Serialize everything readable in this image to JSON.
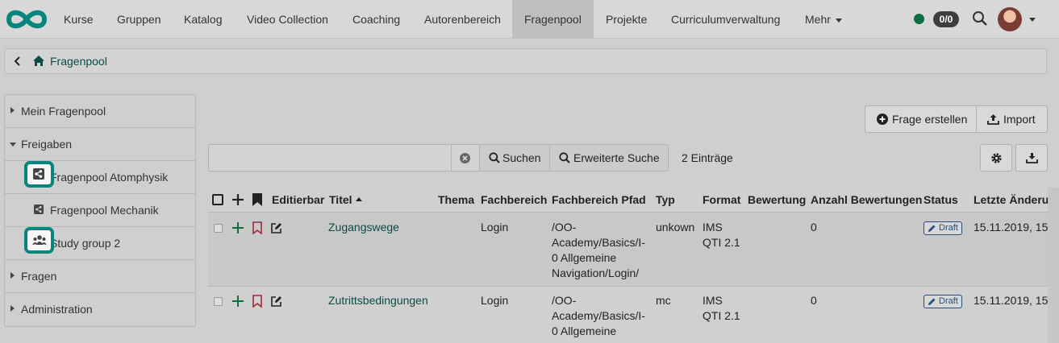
{
  "nav": {
    "items": [
      {
        "label": "Kurse",
        "active": false
      },
      {
        "label": "Gruppen",
        "active": false
      },
      {
        "label": "Katalog",
        "active": false
      },
      {
        "label": "Video Collection",
        "active": false
      },
      {
        "label": "Coaching",
        "active": false
      },
      {
        "label": "Autorenbereich",
        "active": false
      },
      {
        "label": "Fragenpool",
        "active": true
      },
      {
        "label": "Projekte",
        "active": false
      },
      {
        "label": "Curriculumverwaltung",
        "active": false
      },
      {
        "label": "Mehr",
        "active": false
      }
    ],
    "status_color": "#0d6e42",
    "badge": "0/0"
  },
  "breadcrumb": {
    "label": "Fragenpool"
  },
  "sidebar": {
    "items": [
      {
        "label": "Mein Fragenpool",
        "expanded": false
      },
      {
        "label": "Freigaben",
        "expanded": true
      },
      {
        "label": "Fragenpool Atomphysik",
        "icon": "share-icon",
        "highlighted": true
      },
      {
        "label": "Fragenpool Mechanik",
        "icon": "share-icon",
        "highlighted": false
      },
      {
        "label": "Study group 2",
        "icon": "group-icon",
        "highlighted": true
      },
      {
        "label": "Fragen",
        "expanded": false
      },
      {
        "label": "Administration",
        "expanded": false
      }
    ]
  },
  "toolbar": {
    "create_label": "Frage erstellen",
    "import_label": "Import",
    "search_label": "Suchen",
    "advanced_search_label": "Erweiterte Suche",
    "search_value": "",
    "count_label": "2 Einträge"
  },
  "table": {
    "headers": [
      "Editierbar",
      "Titel",
      "Thema",
      "Fachbereich",
      "Fachbereich Pfad",
      "Typ",
      "Format",
      "Bewertung",
      "Anzahl Bewertungen",
      "Status",
      "Letzte Änderung"
    ],
    "rows": [
      {
        "title": "Zugangswege",
        "thema": "",
        "fachbereich": "Login",
        "pfad": [
          "/OO-",
          "Academy/Basics/I-",
          "0 Allgemeine",
          "Navigation/Login/"
        ],
        "typ": "unkown",
        "format": [
          "IMS",
          "QTI 2.1"
        ],
        "bewertung": "",
        "anzahl": "0",
        "status": "Draft",
        "date": "15.11.2019, 15"
      },
      {
        "title": "Zutrittsbedingungen",
        "thema": "",
        "fachbereich": "Login",
        "pfad": [
          "/OO-",
          "Academy/Basics/I-",
          "0 Allgemeine"
        ],
        "typ": "mc",
        "format": [
          "IMS",
          "QTI 2.1"
        ],
        "bewertung": "",
        "anzahl": "0",
        "status": "Draft",
        "date": "15.11.2019, 15"
      }
    ]
  },
  "colors": {
    "accent": "#08857c",
    "link": "#0b4c44",
    "bookmark": "#a0283c",
    "plus": "#0d6e42"
  }
}
